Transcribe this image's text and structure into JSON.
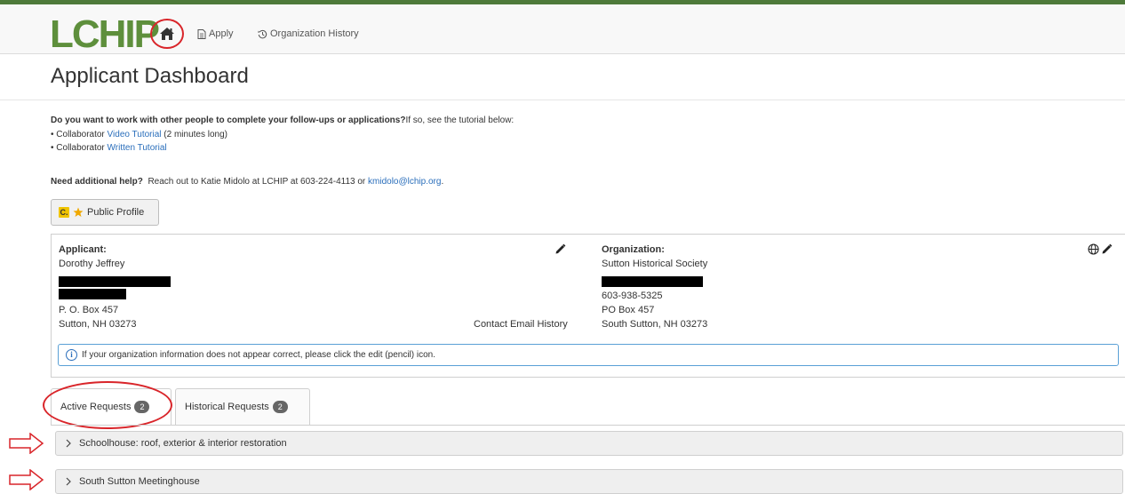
{
  "navbar": {
    "logo_text": "LCHIP",
    "home_icon": "home-icon",
    "apply_label": "Apply",
    "apply_icon": "document-icon",
    "history_label": "Organization History",
    "history_icon": "history-icon"
  },
  "page": {
    "title": "Applicant Dashboard"
  },
  "intro": {
    "question_bold": "Do you want to work with other people to complete your follow-ups or applications?",
    "question_rest": "If so, see the tutorial below:",
    "bullets": [
      {
        "prefix": "Collaborator ",
        "link": "Video Tutorial",
        "suffix": " (2 minutes long)"
      },
      {
        "prefix": "Collaborator ",
        "link": "Written Tutorial",
        "suffix": ""
      }
    ]
  },
  "help": {
    "bold": "Need additional help?",
    "text": "  Reach out to Katie Midolo at LCHIP at 603-224-4113 or ",
    "email": "kmidolo@lchip.org",
    "end": "."
  },
  "profile_button": {
    "badge": "C.",
    "label": "Public Profile"
  },
  "applicant": {
    "label": "Applicant:",
    "name": "Dorothy Jeffrey",
    "address1": "P. O. Box 457",
    "address2": "Sutton, NH 03273",
    "contact_history_link": "Contact Email History"
  },
  "organization": {
    "label": "Organization:",
    "name": "Sutton Historical Society",
    "phone": "603-938-5325",
    "address1": "PO Box 457",
    "address2": "South Sutton, NH 03273"
  },
  "info_bar": {
    "icon": "info-icon",
    "text": "If your organization information does not appear correct, please click the edit (pencil) icon."
  },
  "tabs": [
    {
      "label": "Active Requests",
      "count": "2"
    },
    {
      "label": "Historical Requests",
      "count": "2"
    }
  ],
  "requests": [
    {
      "title": "Schoolhouse: roof, exterior & interior restoration"
    },
    {
      "title": "South Sutton Meetinghouse"
    }
  ],
  "colors": {
    "brand_green": "#5e8f3c",
    "annotation_red": "#d9252a",
    "link_blue": "#2a6ebb"
  }
}
